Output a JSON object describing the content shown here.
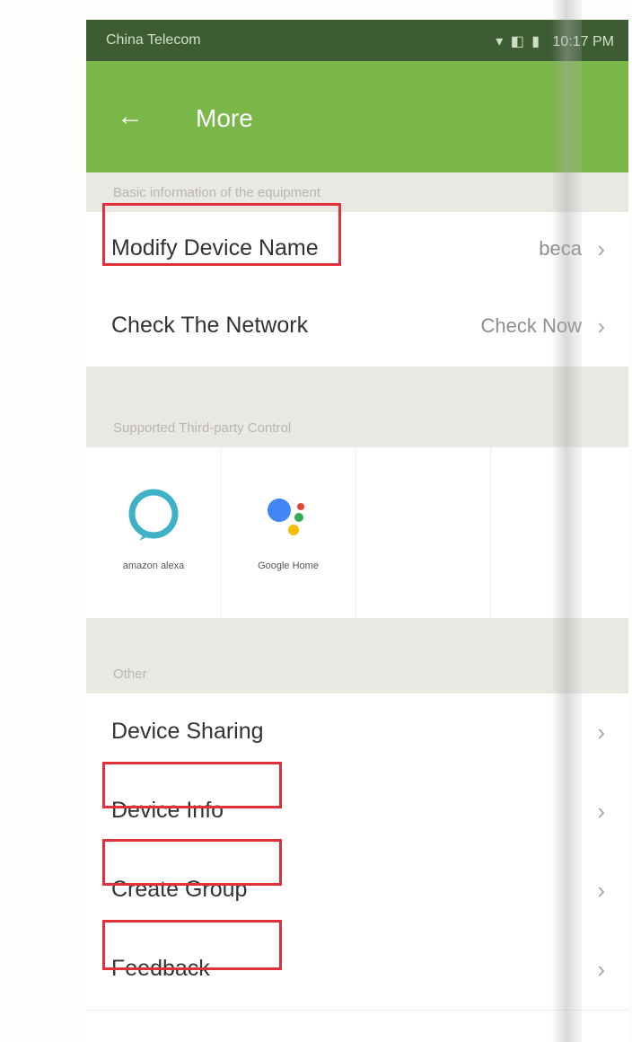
{
  "status_bar": {
    "carrier": "China Telecom",
    "icons": "▾ ◧ ▮",
    "time": "10:17 PM"
  },
  "app_bar": {
    "back_icon": "←",
    "title": "More"
  },
  "sections": {
    "basic": "Basic information of the equipment",
    "supported": "Supported Third-party Control",
    "other": "Other"
  },
  "basic_rows": [
    {
      "label": "Modify Device Name",
      "value": "beca",
      "icon": "chevron-right-icon"
    },
    {
      "label": "Check The Network",
      "value": "Check Now",
      "icon": "chevron-right-icon"
    }
  ],
  "assistants": [
    {
      "name": "amazon alexa",
      "icon": "alexa-ring-icon"
    },
    {
      "name": "Google Home",
      "icon": "google-assistant-icon"
    }
  ],
  "other_rows": [
    {
      "label": "Device Sharing"
    },
    {
      "label": "Device Info"
    },
    {
      "label": "Create Group"
    },
    {
      "label": "Feedback"
    }
  ],
  "chevron": "›",
  "colors": {
    "status_bar": "#3d5c33",
    "app_bar": "#7ab648",
    "section_header": "#e9e8e3",
    "annotation": "#e0303a",
    "alexa": "#3fb1c6",
    "google_blue": "#4285f4",
    "google_red": "#ea4335",
    "google_yellow": "#fbbc05",
    "google_green": "#34a853"
  }
}
